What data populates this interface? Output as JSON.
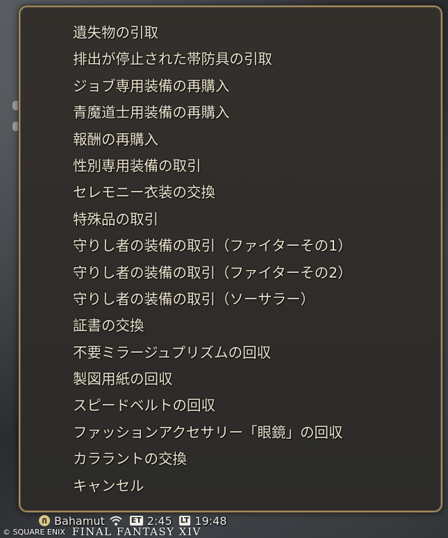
{
  "menu": {
    "items": [
      {
        "label": "遺失物の引取"
      },
      {
        "label": "排出が停止された帯防具の引取"
      },
      {
        "label": "ジョブ専用装備の再購入"
      },
      {
        "label": "青魔道士用装備の再購入"
      },
      {
        "label": "報酬の再購入"
      },
      {
        "label": "性別専用装備の取引"
      },
      {
        "label": "セレモニー衣装の交換"
      },
      {
        "label": "特殊品の取引"
      },
      {
        "label": "守りし者の装備の取引（ファイターその1）"
      },
      {
        "label": "守りし者の装備の取引（ファイターその2）"
      },
      {
        "label": "守りし者の装備の取引（ソーサラー）"
      },
      {
        "label": "証書の交換"
      },
      {
        "label": "不要ミラージュプリズムの回収"
      },
      {
        "label": "製図用紙の回収"
      },
      {
        "label": "スピードベルトの回収"
      },
      {
        "label": "ファッションアクセサリー「眼鏡」の回収"
      },
      {
        "label": "カララントの交換"
      },
      {
        "label": "キャンセル"
      }
    ]
  },
  "status": {
    "server": "Bahamut",
    "et_label": "ET",
    "et_time": "2:45",
    "lt_label": "LT",
    "lt_time": "19:48",
    "icons": [
      "server-icon",
      "connection-icon"
    ]
  },
  "footer": {
    "copyright": "© SQUARE ENIX",
    "game_logo": "FINAL FANTASY XIV"
  },
  "colors": {
    "menu_text": "#ece3cf",
    "window_border": "#a48d62",
    "window_bg": "#2c2b29"
  }
}
